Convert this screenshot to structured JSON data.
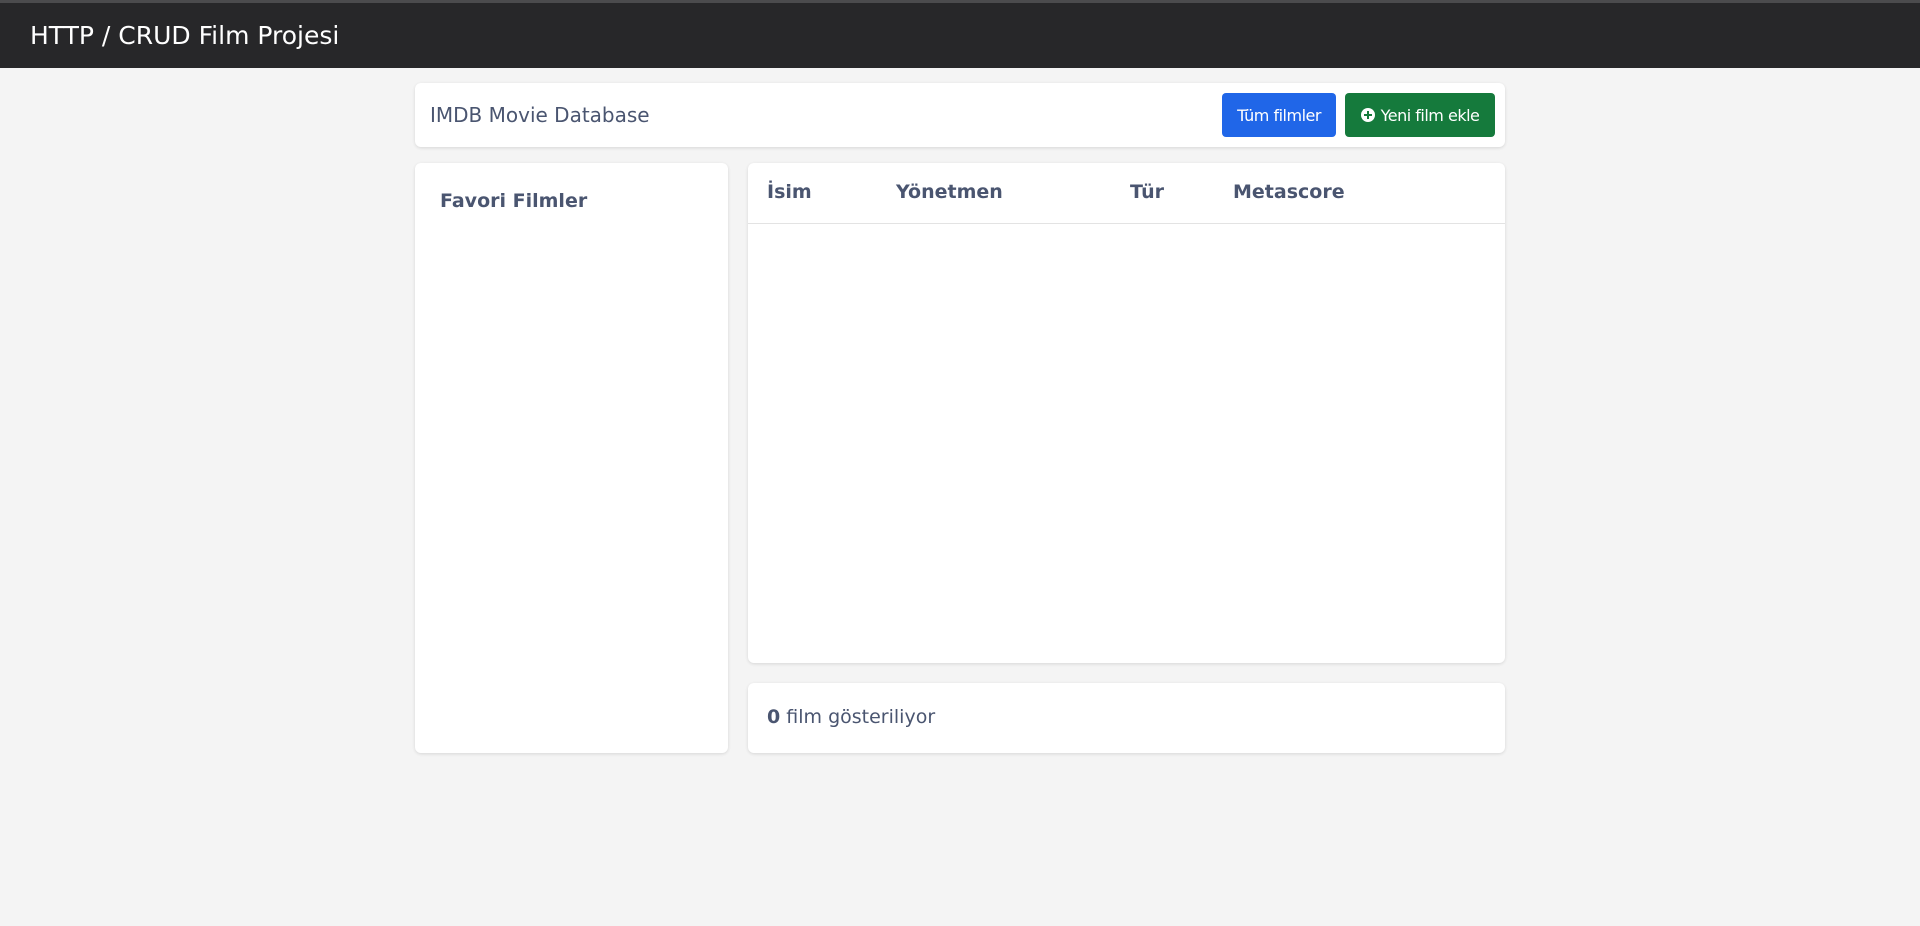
{
  "navbar": {
    "title": "HTTP / CRUD Film Projesi"
  },
  "header": {
    "title": "IMDB Movie Database",
    "all_movies_label": "Tüm filmler",
    "add_movie_label": "Yeni film ekle",
    "add_icon": "plus-circle-icon"
  },
  "favorites": {
    "title": "Favori Filmler"
  },
  "table": {
    "columns": [
      "İsim",
      "Yönetmen",
      "Tür",
      "Metascore"
    ],
    "rows": []
  },
  "footer": {
    "count": "0",
    "text": "film gösteriliyor"
  },
  "colors": {
    "navbar_bg": "#272729",
    "primary": "#2066e8",
    "success": "#157a3c",
    "page_bg": "#f4f4f4",
    "text": "#4a5570"
  }
}
